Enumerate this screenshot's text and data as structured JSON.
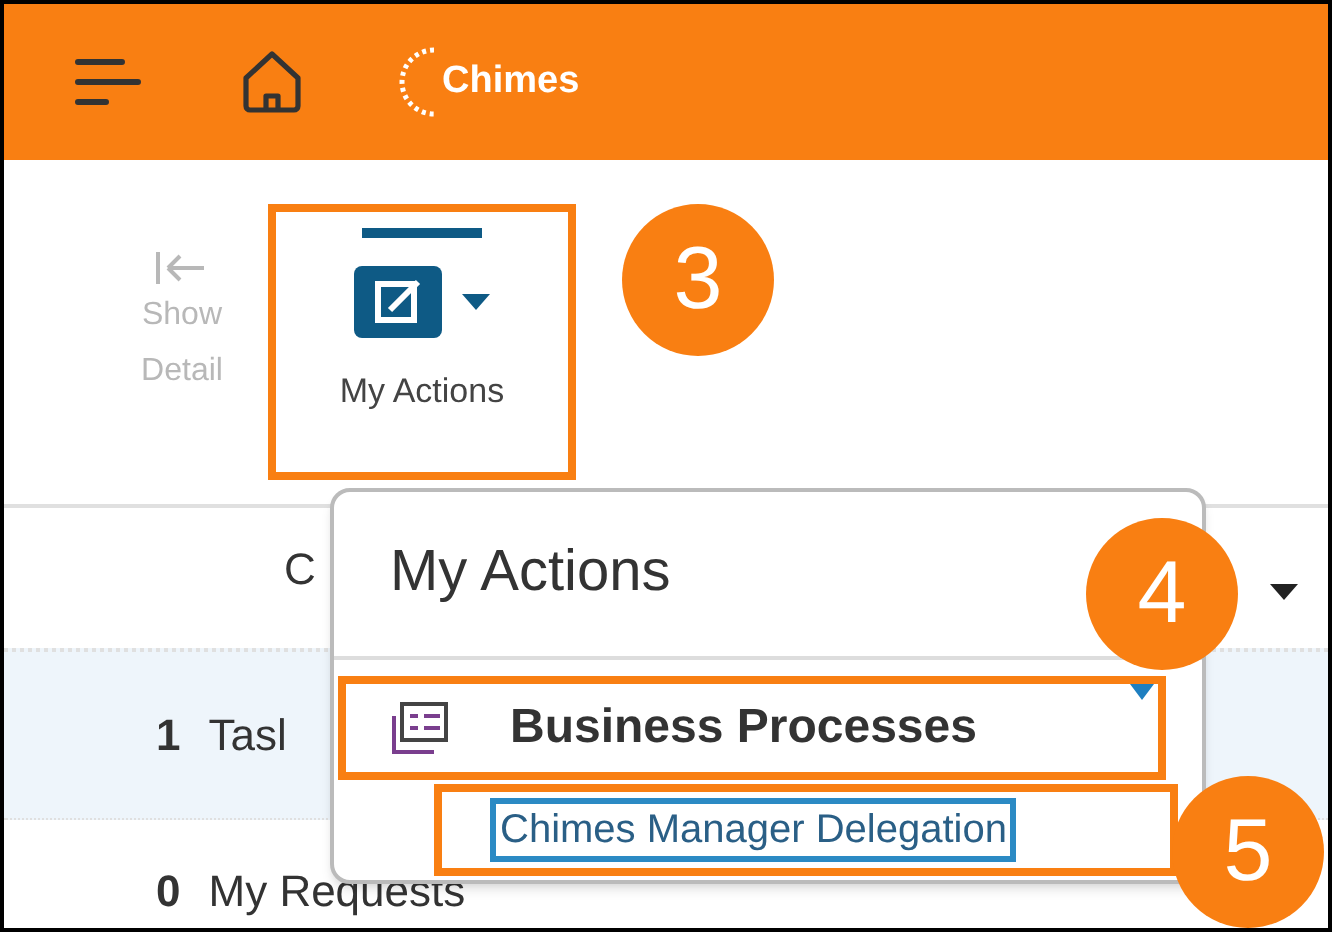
{
  "header": {
    "logo": "Chimes"
  },
  "toolbar": [
    {
      "label": "Show Detail",
      "disabled": true
    },
    {
      "label": "My Actions",
      "disabled": false,
      "annotated": true
    }
  ],
  "table": {
    "column_1": "C",
    "rows": [
      {
        "count": "1",
        "label": "Tasl",
        "selected": true
      },
      {
        "count": "0",
        "label": "My Requests",
        "selected": false
      }
    ]
  },
  "menu": {
    "title": "My Actions",
    "items": [
      {
        "label": "Business Processes",
        "expanded": true,
        "annotated": true,
        "children": [
          {
            "label": "Chimes Manager Delegation",
            "focused": true,
            "annotated": true
          }
        ]
      }
    ]
  },
  "callouts": [
    "3",
    "4",
    "5"
  ]
}
